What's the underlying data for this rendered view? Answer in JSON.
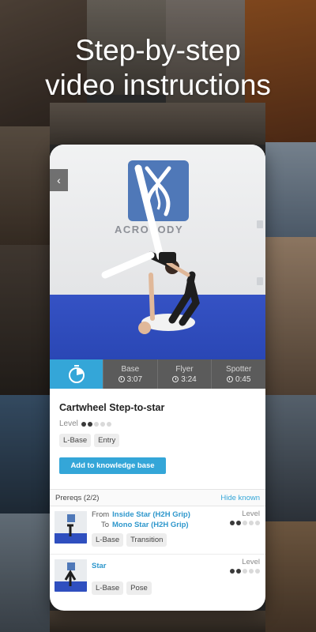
{
  "headline": {
    "line1": "Step-by-step",
    "line2": "video instructions"
  },
  "colors": {
    "accent": "#34a6d8",
    "tab_bg": "#5b5b5b",
    "card_bg": "#ffffff"
  },
  "video": {
    "logo_text": "ACROYODY",
    "back_icon": "chevron-left-icon"
  },
  "tabs": {
    "main_icon": "timer-icon",
    "items": [
      {
        "label": "Base",
        "time": "3:07"
      },
      {
        "label": "Flyer",
        "time": "3:24"
      },
      {
        "label": "Spotter",
        "time": "0:45"
      }
    ]
  },
  "pose": {
    "title": "Cartwheel Step-to-star",
    "level_label": "Level",
    "level": 2,
    "level_max": 5,
    "tags": [
      "L-Base",
      "Entry"
    ],
    "add_button": "Add to knowledge base"
  },
  "prereqs": {
    "label": "Prereqs (2/2)",
    "hide_link": "Hide known",
    "items": [
      {
        "from_label": "From",
        "from": "Inside Star (H2H Grip)",
        "to_label": "To",
        "to": "Mono Star (H2H Grip)",
        "level_label": "Level",
        "level": 2,
        "tags": [
          "L-Base",
          "Transition"
        ]
      },
      {
        "name": "Star",
        "level_label": "Level",
        "level": 2,
        "tags": [
          "L-Base",
          "Pose"
        ]
      }
    ]
  }
}
